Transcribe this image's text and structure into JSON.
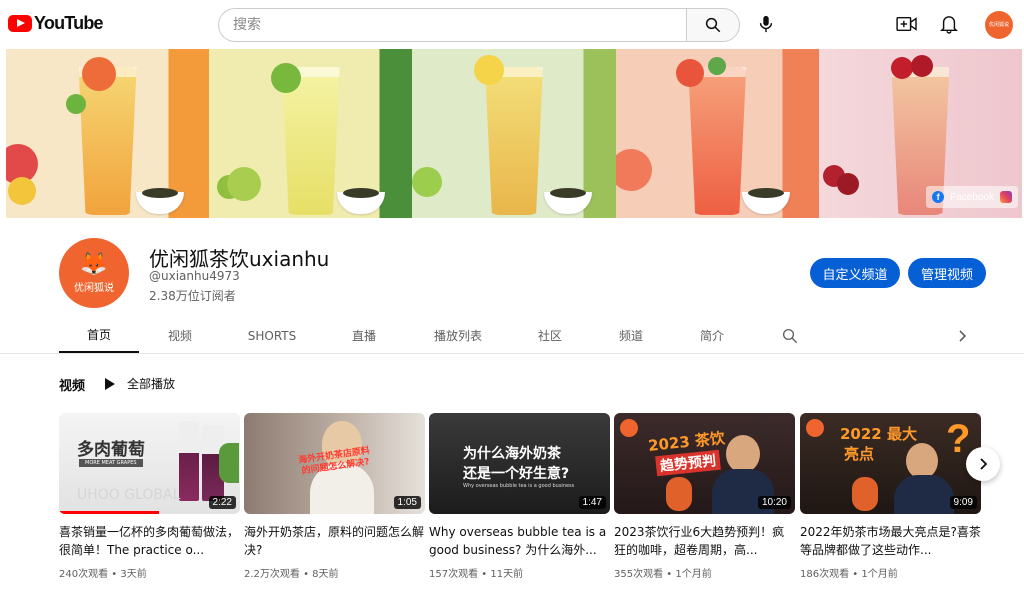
{
  "header": {
    "logo_text": "YouTube",
    "search_placeholder": "搜索"
  },
  "banner": {
    "social_label": "Facebook"
  },
  "channel": {
    "avatar_label": "优闲狐说",
    "name": "优闲狐茶饮uxianhu",
    "handle": "@uxianhu4973",
    "subscribers": "2.38万位订阅者",
    "customize_button": "自定义频道",
    "manage_button": "管理视频"
  },
  "tabs": [
    "首页",
    "视频",
    "SHORTS",
    "直播",
    "播放列表",
    "社区",
    "频道",
    "简介"
  ],
  "section": {
    "title": "视频",
    "play_all": "全部播放"
  },
  "videos": [
    {
      "title": "喜茶销量一亿杯的多肉葡萄做法，很简单！The practice o...",
      "duration": "2:22",
      "views": "240次观看",
      "age": "3天前",
      "progress": 0.55,
      "thumb_text": "多肉葡萄",
      "thumb_sub": "MORE MEAT GRAPES",
      "thumb_brand": "UHOO GLOBAL"
    },
    {
      "title": "海外开奶茶店，原料的问题怎么解决?",
      "duration": "1:05",
      "views": "2.2万次观看",
      "age": "8天前",
      "progress": 0.0,
      "thumb_text": "海外开奶茶店原料的问题怎么解决?"
    },
    {
      "title": "Why overseas bubble tea is a good business? 为什么海外...",
      "duration": "1:47",
      "views": "157次观看",
      "age": "11天前",
      "progress": 0.0,
      "thumb_text_line1": "为什么海外奶茶",
      "thumb_text_line2": "还是一个好生意?",
      "thumb_sub": "Why overseas bubble tea is a good business"
    },
    {
      "title": "2023茶饮行业6大趋势预判！疯狂的咖啡，超卷周期，高...",
      "duration": "10:20",
      "views": "355次观看",
      "age": "1个月前",
      "progress": 0.0,
      "thumb_text_line1": "2023 茶饮",
      "thumb_text_line2": "趋势预判"
    },
    {
      "title": "2022年奶茶市场最大亮点是?喜茶等品牌都做了这些动作...",
      "duration": "9:09",
      "views": "186次观看",
      "age": "1个月前",
      "progress": 0.0,
      "thumb_text_line1": "2022 最大",
      "thumb_text_line2": "亮点"
    }
  ],
  "colors": {
    "brand_red": "#ff0000",
    "action_blue": "#065fd4",
    "avatar_orange": "#f0642f"
  }
}
